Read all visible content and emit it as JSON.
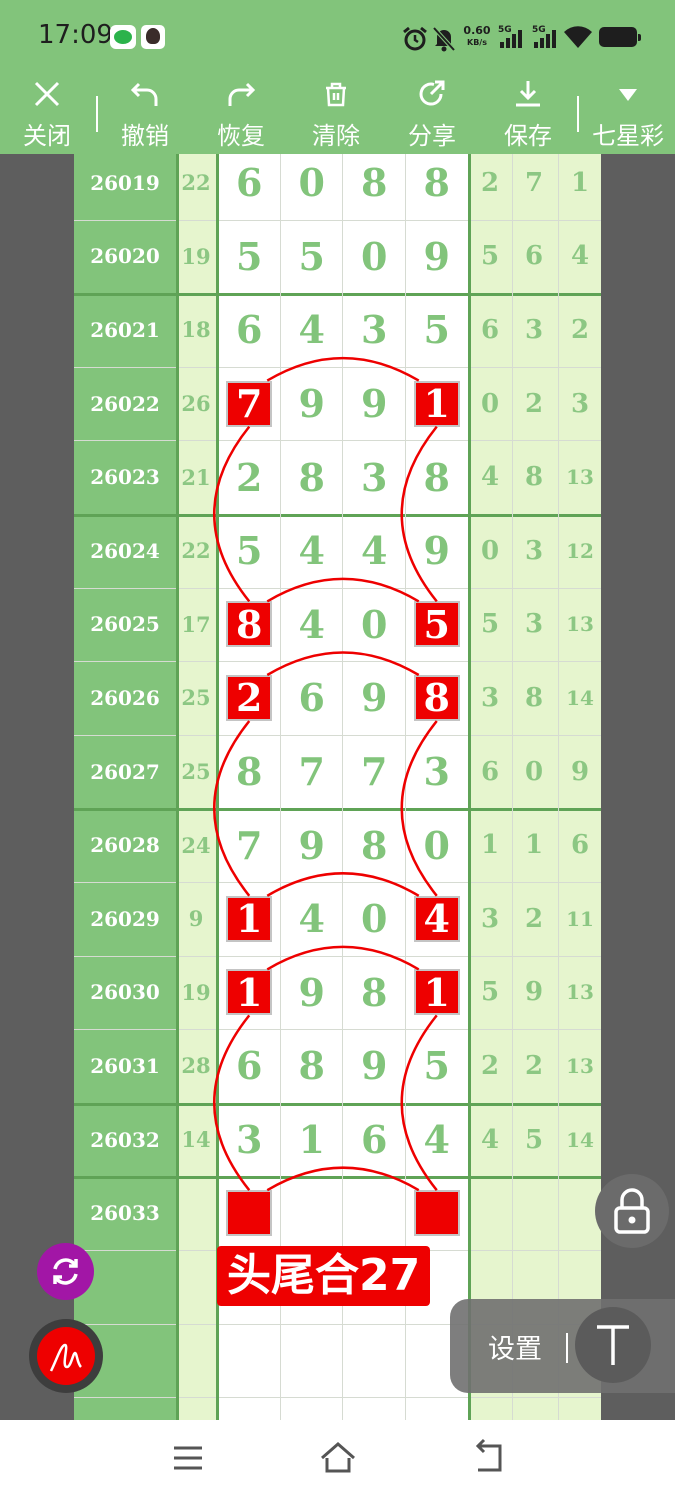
{
  "status_bar": {
    "time": "17:09",
    "net_speed_value": "0.60",
    "net_speed_unit": "KB/s",
    "signal_1_label": "5G",
    "signal_2_label": "5G",
    "icons": [
      "wechat-icon",
      "user-avatar-icon",
      "alarm-icon",
      "mute-bell-icon",
      "signal-icon",
      "signal-icon",
      "wifi-icon",
      "battery-icon"
    ]
  },
  "toolbar": {
    "close": "关闭",
    "undo": "撤销",
    "redo": "恢复",
    "clear": "清除",
    "share": "分享",
    "save": "保存",
    "lottery": "七星彩"
  },
  "rows": [
    {
      "issue": "26019",
      "sum": "22",
      "digits": [
        "6",
        "0",
        "8",
        "8"
      ],
      "right": [
        "2",
        "7",
        "1"
      ]
    },
    {
      "issue": "26020",
      "sum": "19",
      "digits": [
        "5",
        "5",
        "0",
        "9"
      ],
      "right": [
        "5",
        "6",
        "4"
      ]
    },
    {
      "issue": "26021",
      "sum": "18",
      "digits": [
        "6",
        "4",
        "3",
        "5"
      ],
      "right": [
        "6",
        "3",
        "2"
      ]
    },
    {
      "issue": "26022",
      "sum": "26",
      "digits": [
        "7",
        "9",
        "9",
        "1"
      ],
      "right": [
        "0",
        "2",
        "3"
      ]
    },
    {
      "issue": "26023",
      "sum": "21",
      "digits": [
        "2",
        "8",
        "3",
        "8"
      ],
      "right": [
        "4",
        "8",
        "13"
      ]
    },
    {
      "issue": "26024",
      "sum": "22",
      "digits": [
        "5",
        "4",
        "4",
        "9"
      ],
      "right": [
        "0",
        "3",
        "12"
      ]
    },
    {
      "issue": "26025",
      "sum": "17",
      "digits": [
        "8",
        "4",
        "0",
        "5"
      ],
      "right": [
        "5",
        "3",
        "13"
      ]
    },
    {
      "issue": "26026",
      "sum": "25",
      "digits": [
        "2",
        "6",
        "9",
        "8"
      ],
      "right": [
        "3",
        "8",
        "14"
      ]
    },
    {
      "issue": "26027",
      "sum": "25",
      "digits": [
        "8",
        "7",
        "7",
        "3"
      ],
      "right": [
        "6",
        "0",
        "9"
      ]
    },
    {
      "issue": "26028",
      "sum": "24",
      "digits": [
        "7",
        "9",
        "8",
        "0"
      ],
      "right": [
        "1",
        "1",
        "6"
      ]
    },
    {
      "issue": "26029",
      "sum": "9",
      "digits": [
        "1",
        "4",
        "0",
        "4"
      ],
      "right": [
        "3",
        "2",
        "11"
      ]
    },
    {
      "issue": "26030",
      "sum": "19",
      "digits": [
        "1",
        "9",
        "8",
        "1"
      ],
      "right": [
        "5",
        "9",
        "13"
      ]
    },
    {
      "issue": "26031",
      "sum": "28",
      "digits": [
        "6",
        "8",
        "9",
        "5"
      ],
      "right": [
        "2",
        "2",
        "13"
      ]
    },
    {
      "issue": "26032",
      "sum": "14",
      "digits": [
        "3",
        "1",
        "6",
        "4"
      ],
      "right": [
        "4",
        "5",
        "14"
      ]
    },
    {
      "issue": "26033",
      "sum": "",
      "digits": [
        "",
        "",
        "",
        ""
      ],
      "right": [
        "",
        "",
        ""
      ]
    }
  ],
  "highlighted_rows": [
    3,
    6,
    7,
    10,
    11,
    14
  ],
  "annotation": {
    "label": "头尾合27",
    "color": "#ee0000"
  },
  "floating": {
    "settings": "设置"
  },
  "colors": {
    "header": "#82c47b",
    "highlight": "#ee0000",
    "digit": "#82c47b",
    "light_col": "#e6f5ce"
  },
  "navbar": {
    "icons": [
      "menu-icon",
      "home-icon",
      "back-icon"
    ]
  }
}
